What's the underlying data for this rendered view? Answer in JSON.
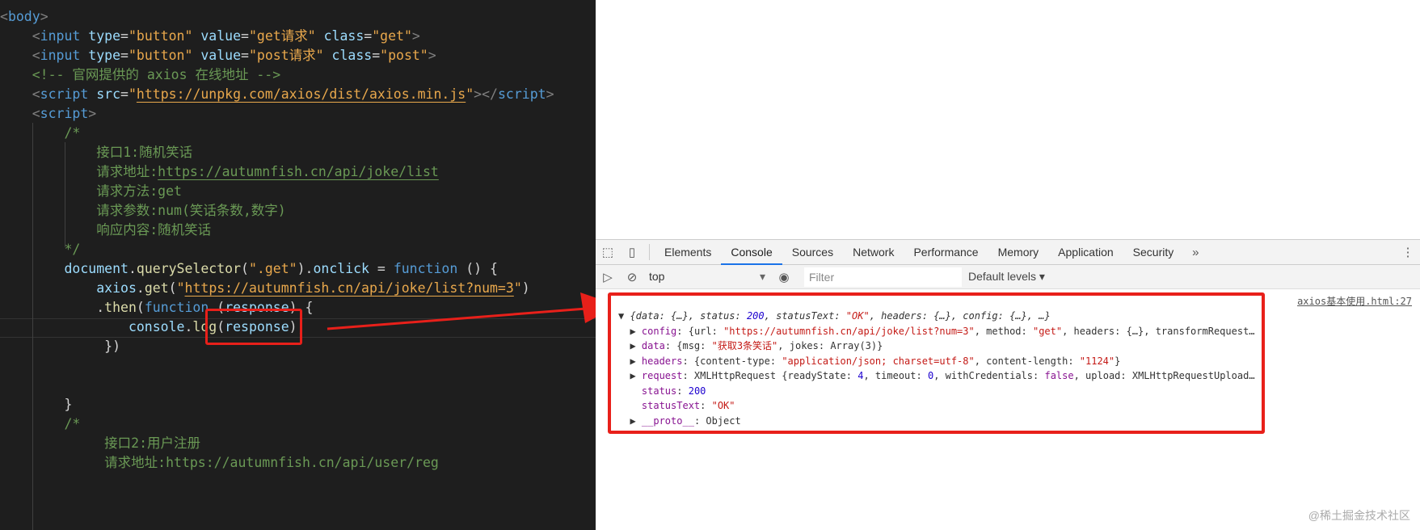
{
  "editor": {
    "lines": [
      [
        [
          "<",
          "tg"
        ],
        [
          "body",
          "tn"
        ],
        [
          ">",
          "tg"
        ]
      ],
      [
        [
          "    <",
          "tg"
        ],
        [
          "input",
          "tn"
        ],
        [
          " type",
          "at"
        ],
        [
          "=",
          "tx"
        ],
        [
          "\"button\"",
          "st"
        ],
        [
          " value",
          "at"
        ],
        [
          "=",
          "tx"
        ],
        [
          "\"get请求\"",
          "st"
        ],
        [
          " class",
          "at"
        ],
        [
          "=",
          "tx"
        ],
        [
          "\"get\"",
          "st"
        ],
        [
          ">",
          "tg"
        ]
      ],
      [
        [
          "    <",
          "tg"
        ],
        [
          "input",
          "tn"
        ],
        [
          " type",
          "at"
        ],
        [
          "=",
          "tx"
        ],
        [
          "\"button\"",
          "st"
        ],
        [
          " value",
          "at"
        ],
        [
          "=",
          "tx"
        ],
        [
          "\"post请求\"",
          "st"
        ],
        [
          " class",
          "at"
        ],
        [
          "=",
          "tx"
        ],
        [
          "\"post\"",
          "st"
        ],
        [
          ">",
          "tg"
        ]
      ],
      [
        [
          "    <!-- 官网提供的 axios 在线地址 -->",
          "cm"
        ]
      ],
      [
        [
          "    <",
          "tg"
        ],
        [
          "script",
          "tn"
        ],
        [
          " src",
          "at"
        ],
        [
          "=",
          "tx"
        ],
        [
          "\"",
          "st"
        ],
        [
          "https://unpkg.com/axios/dist/axios.min.js",
          "st ul"
        ],
        [
          "\"",
          "st"
        ],
        [
          "></",
          "tg"
        ],
        [
          "script",
          "tn"
        ],
        [
          ">",
          "tg"
        ]
      ],
      [
        [
          "    <",
          "tg"
        ],
        [
          "script",
          "tn"
        ],
        [
          ">",
          "tg"
        ]
      ],
      [
        [
          "        /*",
          "cm"
        ]
      ],
      [
        [
          "            接口1:随机笑话",
          "cm"
        ]
      ],
      [
        [
          "            请求地址:",
          "cm"
        ],
        [
          "https://autumnfish.cn/api/joke/list",
          "cm ulg"
        ]
      ],
      [
        [
          "            请求方法:get",
          "cm"
        ]
      ],
      [
        [
          "            请求参数:num(笑话条数,数字)",
          "cm"
        ]
      ],
      [
        [
          "            响应内容:随机笑话",
          "cm"
        ]
      ],
      [
        [
          "        */",
          "cm"
        ]
      ],
      [
        [
          "        document",
          "vr"
        ],
        [
          ".",
          "tx"
        ],
        [
          "querySelector",
          "fn"
        ],
        [
          "(",
          "tx"
        ],
        [
          "\".get\"",
          "st"
        ],
        [
          ").",
          "tx"
        ],
        [
          "onclick",
          "vr"
        ],
        [
          " = ",
          "tx"
        ],
        [
          "function",
          "kw"
        ],
        [
          " () {",
          "tx"
        ]
      ],
      [
        [
          "            axios",
          "vr"
        ],
        [
          ".",
          "tx"
        ],
        [
          "get",
          "fn"
        ],
        [
          "(",
          "tx"
        ],
        [
          "\"",
          "st"
        ],
        [
          "https://autumnfish.cn/api/joke/list?num=3",
          "st ul"
        ],
        [
          "\"",
          "st"
        ],
        [
          ")",
          "tx"
        ]
      ],
      [
        [
          "            .",
          "tx"
        ],
        [
          "then",
          "fn"
        ],
        [
          "(",
          "tx"
        ],
        [
          "function",
          "kw"
        ],
        [
          " (",
          "tx"
        ],
        [
          "response",
          "vr"
        ],
        [
          ") {",
          "tx"
        ]
      ],
      [
        [
          "                console",
          "vr"
        ],
        [
          ".",
          "tx"
        ],
        [
          "log",
          "fn"
        ],
        [
          "(",
          "tx"
        ],
        [
          "response",
          "vr"
        ],
        [
          ");",
          "tx"
        ]
      ],
      [
        [
          "             })",
          "tx"
        ]
      ],
      [],
      [],
      [
        [
          "        }",
          "tx"
        ]
      ],
      [
        [
          "        /*",
          "cm"
        ]
      ],
      [
        [
          "             接口2:用户注册",
          "cm"
        ]
      ],
      [
        [
          "             请求地址:https://autumnfish.cn/api/user/reg",
          "cm"
        ]
      ]
    ]
  },
  "devtools": {
    "tabs": [
      "Elements",
      "Console",
      "Sources",
      "Network",
      "Performance",
      "Memory",
      "Application",
      "Security"
    ],
    "more": "»",
    "menu": "⋮",
    "context": "top",
    "filter_placeholder": "Filter",
    "levels": "Default levels ▾",
    "source_link": "axios基本使用.html:27",
    "console_lines": [
      [
        [
          "▼ ",
          "g"
        ],
        [
          "{data: {…}, status: ",
          "g i"
        ],
        [
          "200",
          "n i"
        ],
        [
          ", statusText: ",
          "g i"
        ],
        [
          "\"OK\"",
          "s i"
        ],
        [
          ", headers: {…}, config: {…}, …}",
          "g i"
        ]
      ],
      [
        [
          "  ▶ ",
          "g"
        ],
        [
          "config",
          "k"
        ],
        [
          ": {url: ",
          "g"
        ],
        [
          "\"https://autumnfish.cn/api/joke/list?num=3\"",
          "s"
        ],
        [
          ", method: ",
          "g"
        ],
        [
          "\"get\"",
          "s"
        ],
        [
          ", headers: {…}, transformRequest…",
          "g"
        ]
      ],
      [
        [
          "  ▶ ",
          "g"
        ],
        [
          "data",
          "k"
        ],
        [
          ": {msg: ",
          "g"
        ],
        [
          "\"获取3条笑话\"",
          "s"
        ],
        [
          ", jokes: Array(3)}",
          "g"
        ]
      ],
      [
        [
          "  ▶ ",
          "g"
        ],
        [
          "headers",
          "k"
        ],
        [
          ": {content-type: ",
          "g"
        ],
        [
          "\"application/json; charset=utf-8\"",
          "s"
        ],
        [
          ", content-length: ",
          "g"
        ],
        [
          "\"1124\"",
          "s"
        ],
        [
          "}",
          "g"
        ]
      ],
      [
        [
          "  ▶ ",
          "g"
        ],
        [
          "request",
          "k"
        ],
        [
          ": XMLHttpRequest {readyState: ",
          "g"
        ],
        [
          "4",
          "n"
        ],
        [
          ", timeout: ",
          "g"
        ],
        [
          "0",
          "n"
        ],
        [
          ", withCredentials: ",
          "g"
        ],
        [
          "false",
          "k"
        ],
        [
          ", upload: XMLHttpRequestUpload…",
          "g"
        ]
      ],
      [
        [
          "    ",
          "g"
        ],
        [
          "status",
          "k"
        ],
        [
          ": ",
          "g"
        ],
        [
          "200",
          "n"
        ]
      ],
      [
        [
          "    ",
          "g"
        ],
        [
          "statusText",
          "k"
        ],
        [
          ": ",
          "g"
        ],
        [
          "\"OK\"",
          "s"
        ]
      ],
      [
        [
          "  ▶ ",
          "g"
        ],
        [
          "__proto__",
          "k"
        ],
        [
          ": Object",
          "g"
        ]
      ]
    ]
  },
  "watermark": "@稀土掘金技术社区",
  "colors": {
    "highlight": "#e8201a",
    "active_tab": "#1a73e8"
  }
}
